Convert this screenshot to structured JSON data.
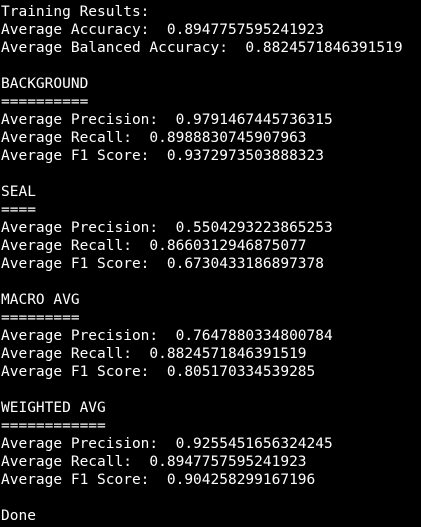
{
  "colors": {
    "background": "#000000",
    "foreground": "#ffffff"
  },
  "terminal": {
    "lines": [
      "Training Results:",
      "Average Accuracy:  0.8947757595241923",
      "Average Balanced Accuracy:  0.8824571846391519",
      "",
      "BACKGROUND",
      "==========",
      "Average Precision:  0.9791467445736315",
      "Average Recall:  0.8988830745907963",
      "Average F1 Score:  0.9372973503888323",
      "",
      "SEAL",
      "====",
      "Average Precision:  0.5504293223865253",
      "Average Recall:  0.8660312946875077",
      "Average F1 Score:  0.6730433186897378",
      "",
      "MACRO AVG",
      "=========",
      "Average Precision:  0.7647880334800784",
      "Average Recall:  0.8824571846391519",
      "Average F1 Score:  0.805170334539285",
      "",
      "WEIGHTED AVG",
      "============",
      "Average Precision:  0.9255451656324245",
      "Average Recall:  0.8947757595241923",
      "Average F1 Score:  0.904258299167196",
      "",
      "Done"
    ]
  }
}
